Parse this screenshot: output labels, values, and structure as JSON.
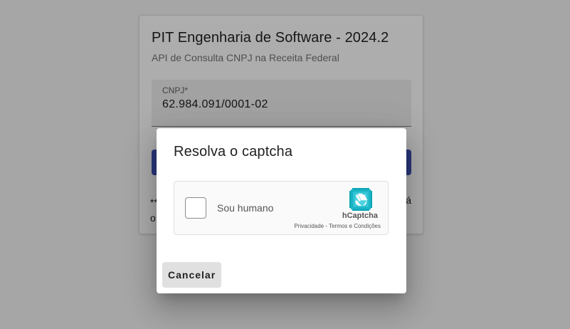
{
  "card": {
    "title": "PIT Engenharia de Software - 2024.2",
    "subtitle": "API de Consulta CNPJ na Receita Federal",
    "cnpj_label": "CNPJ*",
    "cnpj_value": "62.984.091/0001-02",
    "note_left_line1": "**",
    "note_left_line2": "o",
    "note_right": "á"
  },
  "dialog": {
    "title": "Resolva o captcha",
    "captcha_label": "Sou humano",
    "captcha_brand": "hCaptcha",
    "captcha_links": "Privacidade - Termos e Condições",
    "cancel_label": "Cancelar"
  },
  "colors": {
    "primary": "#3f51b5",
    "hcaptcha_teal": "#00a5b8"
  },
  "icons": {
    "captcha_logo": "hcaptcha-hand-icon"
  }
}
